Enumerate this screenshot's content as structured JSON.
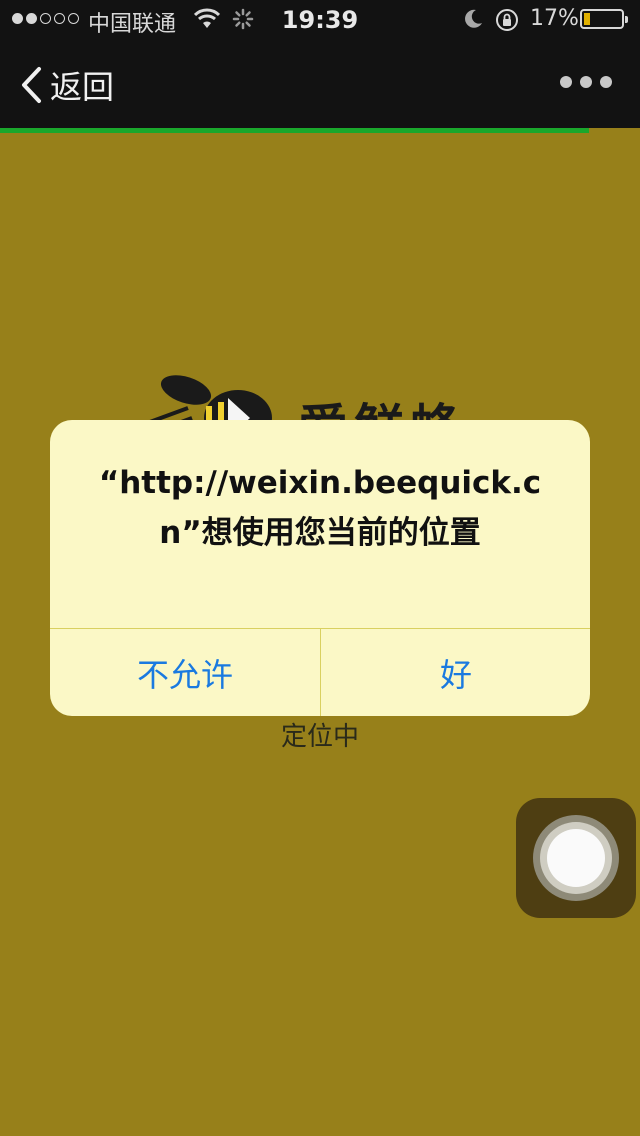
{
  "status_bar": {
    "carrier": "中国联通",
    "time": "19:39",
    "battery_percent": "17%",
    "battery_level": 0.17,
    "signal_strength": 2
  },
  "nav": {
    "back_label": "返回"
  },
  "page": {
    "brand": "爱鲜蜂",
    "status_text": "定位中",
    "load_progress": 0.92
  },
  "alert": {
    "message": "“http://weixin.beequick.cn”想使用您当前的位置",
    "deny_label": "不允许",
    "allow_label": "好"
  },
  "colors": {
    "accent": "#1a7ae0",
    "progress": "#1aa72c",
    "background": "#97801a"
  }
}
